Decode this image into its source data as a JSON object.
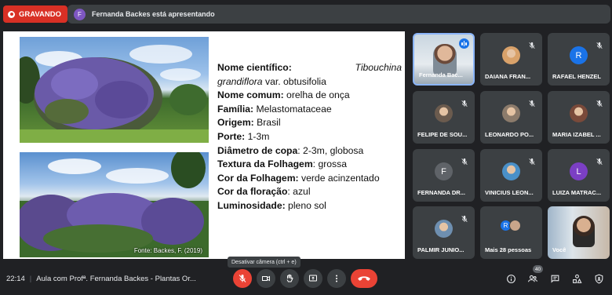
{
  "recording": {
    "label": "GRAVANDO"
  },
  "presenter": {
    "initial": "F",
    "text": "Fernanda Backes está apresentando"
  },
  "slide": {
    "caption": "Fonte: Backes, F. (2019)",
    "sci_label": "Nome científico:",
    "sci_genus": "Tibouchina",
    "sci_species": "grandiflora",
    "sci_rest": " var. obtusifolia",
    "rows": [
      {
        "label": "Nome comum:",
        "value": " orelha de onça"
      },
      {
        "label": "Família:",
        "value": " Melastomataceae"
      },
      {
        "label": "Origem:",
        "value": " Brasil"
      },
      {
        "label": "Porte:",
        "value": " 1-3m"
      },
      {
        "label": "Diâmetro de copa",
        "value": ": 2-3m, globosa"
      },
      {
        "label": "Textura da Folhagem",
        "value": ": grossa"
      },
      {
        "label": "Cor da Folhagem:",
        "value": " verde acinzentado"
      },
      {
        "label": "Cor da floração",
        "value": ": azul"
      },
      {
        "label": "Luminosidade:",
        "value": "  pleno sol"
      }
    ]
  },
  "participants": [
    {
      "name": "Fernanda Bac...",
      "type": "video",
      "speaking": true
    },
    {
      "name": "DAIANA FRAN...",
      "type": "photo",
      "color": "#d9a26a"
    },
    {
      "name": "RAFAEL HENZEL",
      "type": "letter",
      "initial": "R",
      "color": "#1a73e8"
    },
    {
      "name": "FELIPE DE SOU...",
      "type": "photo",
      "color": "#6b5b4e"
    },
    {
      "name": "LEONARDO PO...",
      "type": "photo",
      "color": "#8c7b6b"
    },
    {
      "name": "MARIA IZABEL ...",
      "type": "photo",
      "color": "#7a4a3a"
    },
    {
      "name": "FERNANDA DR...",
      "type": "letter",
      "initial": "F",
      "color": "#5f6368"
    },
    {
      "name": "VINICIUS LEON...",
      "type": "photo",
      "color": "#4a90c8"
    },
    {
      "name": "LUIZA MATRAC...",
      "type": "letter",
      "initial": "L",
      "color": "#7b3fc4"
    },
    {
      "name": "PALMIR JUNIO...",
      "type": "photo",
      "color": "#6e8fb0"
    },
    {
      "name": "Mais 28 pessoas",
      "type": "more",
      "initial": "R",
      "color": "#1a73e8"
    },
    {
      "name": "Você",
      "type": "self"
    }
  ],
  "tooltip": "Desativar câmera (ctrl + e)",
  "bottom": {
    "time": "22:14",
    "meeting_title": "Aula com Profª. Fernanda Backes - Plantas Or...",
    "people_count": "40"
  },
  "icons": {
    "mic_off": "mic-off-icon",
    "camera": "camera-icon",
    "hand": "raise-hand-icon",
    "present": "present-screen-icon",
    "more": "more-vert-icon",
    "end": "end-call-icon",
    "info": "info-icon",
    "people": "people-icon",
    "chat": "chat-icon",
    "activities": "activities-icon",
    "host": "host-controls-icon"
  },
  "colors": {
    "record": "#d93025",
    "end_call": "#ea4335",
    "accent": "#1a73e8",
    "background": "#202124",
    "tile": "#3c4043"
  }
}
